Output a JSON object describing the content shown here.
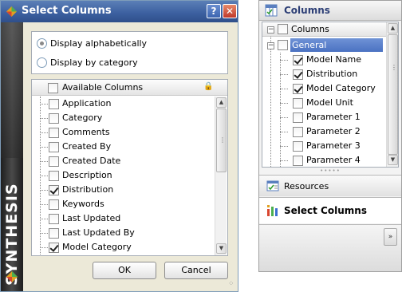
{
  "dialog": {
    "title": "Select Columns",
    "help_label": "?",
    "close_label": "✕",
    "banner": "SYNTHESIS",
    "display_options": [
      {
        "label": "Display alphabetically",
        "selected": true
      },
      {
        "label": "Display by category",
        "selected": false
      }
    ],
    "list": {
      "header": "Available Columns",
      "items": [
        {
          "label": "Application",
          "checked": false
        },
        {
          "label": "Category",
          "checked": false
        },
        {
          "label": "Comments",
          "checked": false
        },
        {
          "label": "Created By",
          "checked": false
        },
        {
          "label": "Created Date",
          "checked": false
        },
        {
          "label": "Description",
          "checked": false
        },
        {
          "label": "Distribution",
          "checked": true
        },
        {
          "label": "Keywords",
          "checked": false
        },
        {
          "label": "Last Updated",
          "checked": false
        },
        {
          "label": "Last Updated By",
          "checked": false
        },
        {
          "label": "Model Category",
          "checked": true
        }
      ]
    },
    "ok_label": "OK",
    "cancel_label": "Cancel"
  },
  "panel": {
    "title": "Columns",
    "tree": {
      "header": "Columns",
      "group": "General",
      "items": [
        {
          "label": "Model Name",
          "checked": true
        },
        {
          "label": "Distribution",
          "checked": true
        },
        {
          "label": "Model Category",
          "checked": true
        },
        {
          "label": "Model Unit",
          "checked": false
        },
        {
          "label": "Parameter 1",
          "checked": false
        },
        {
          "label": "Parameter 2",
          "checked": false
        },
        {
          "label": "Parameter 3",
          "checked": false
        },
        {
          "label": "Parameter 4",
          "checked": false
        }
      ]
    },
    "nav": {
      "resources_label": "Resources",
      "select_columns_label": "Select Columns",
      "chevron": "»"
    }
  },
  "colors": {
    "title_bar": "#3b5f9f",
    "selection": "#4b72c2",
    "banner": "#2a2a2a"
  }
}
